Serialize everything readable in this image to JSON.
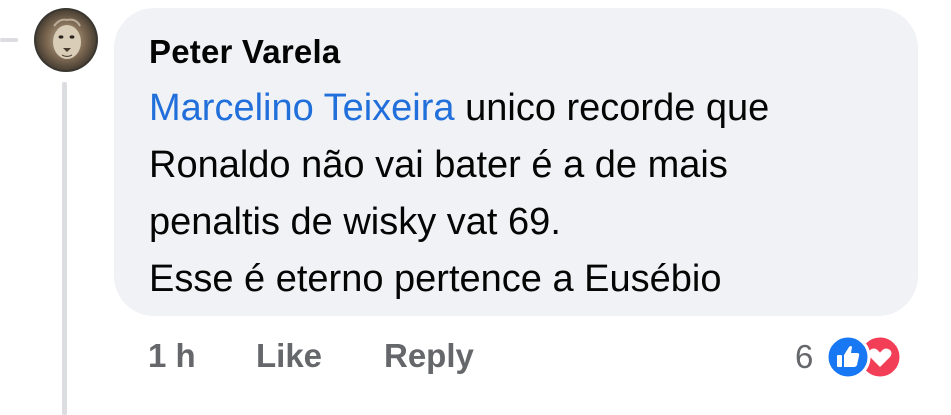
{
  "comment": {
    "author": "Peter Varela",
    "mention": "Marcelino Teixeira",
    "text_lines": [
      " unico recorde que",
      "Ronaldo não vai bater é a de mais",
      "penaltis de wisky vat 69.",
      "Esse é eterno pertence a Eusébio"
    ],
    "avatar_icon": "lion-avatar-icon"
  },
  "actions": {
    "time": "1 h",
    "like_label": "Like",
    "reply_label": "Reply"
  },
  "reactions": {
    "count": "6",
    "icons": [
      "thumbs-up-icon",
      "heart-icon"
    ],
    "like_color": "#1877f2",
    "love_color": "#f33e58"
  },
  "colors": {
    "bubble": "#f0f2f5",
    "mention": "#216fdb",
    "secondary_text": "#65676b"
  }
}
